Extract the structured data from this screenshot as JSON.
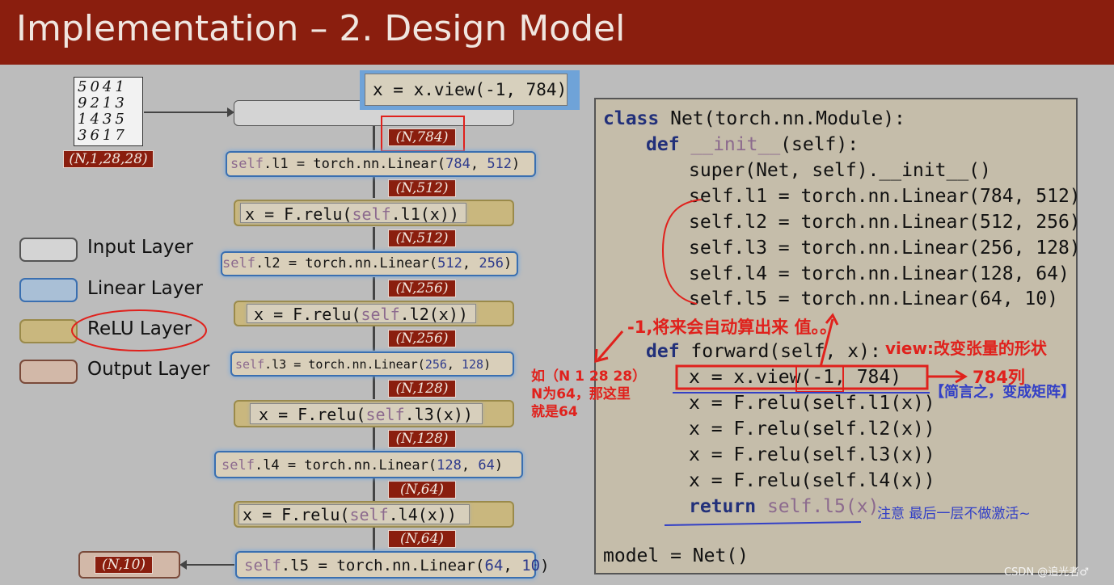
{
  "title": "Implementation – 2. Design Model",
  "input_shape": "(N,1,28,28)",
  "digits": [
    "5041",
    "9213",
    "1435",
    "3617"
  ],
  "flow": {
    "view": "x = x.view(-1, 784)",
    "shapes": [
      "(N,784)",
      "(N,512)",
      "(N,512)",
      "(N,256)",
      "(N,256)",
      "(N,128)",
      "(N,128)",
      "(N,64)",
      "(N,64)"
    ],
    "output_shape": "(N,10)",
    "linear": [
      {
        "pre": "self",
        "mid": ".l1 = torch.nn.Linear(",
        "a": "784",
        "sep": ", ",
        "b": "512",
        "post": ")"
      },
      {
        "pre": "self",
        "mid": ".l2 = torch.nn.Linear(",
        "a": "512",
        "sep": ", ",
        "b": "256",
        "post": ")"
      },
      {
        "pre": "self",
        "mid": ".l3 = torch.nn.Linear(",
        "a": "256",
        "sep": ", ",
        "b": "128",
        "post": ")"
      },
      {
        "pre": "self",
        "mid": ".l4 = torch.nn.Linear(",
        "a": "128",
        "sep": ", ",
        "b": "64",
        "post": ")"
      },
      {
        "pre": "self",
        "mid": ".l5 = torch.nn.Linear(",
        "a": "64",
        "sep": ", ",
        "b": "10",
        "post": ")"
      }
    ],
    "relu": [
      {
        "pre": "x = F.relu(",
        "self": "self",
        "post": ".l1(x))"
      },
      {
        "pre": "x = F.relu(",
        "self": "self",
        "post": ".l2(x))"
      },
      {
        "pre": "x = F.relu(",
        "self": "self",
        "post": ".l3(x))"
      },
      {
        "pre": "x = F.relu(",
        "self": "self",
        "post": ".l4(x))"
      }
    ]
  },
  "legend": [
    {
      "label": "Input Layer",
      "fill": "#d4d4d4",
      "border": "#555555"
    },
    {
      "label": "Linear Layer",
      "fill": "#a9bfd6",
      "border": "#3a6fb0"
    },
    {
      "label": "ReLU Layer",
      "fill": "#c9b77e",
      "border": "#9a8a4a"
    },
    {
      "label": "Output Layer",
      "fill": "#d2b8a8",
      "border": "#7a4a3a"
    }
  ],
  "code": {
    "class_kw": "class",
    "class_rest": " Net(torch.nn.Module):",
    "def_kw": "def",
    "init_name": " __init__",
    "init_args": "(self):",
    "super_line": "super(Net, self).__init__()",
    "l1": "self.l1 = torch.nn.Linear(784, 512)",
    "l2": "self.l2 = torch.nn.Linear(512, 256)",
    "l3": "self.l3 = torch.nn.Linear(256, 128)",
    "l4": "self.l4 = torch.nn.Linear(128, 64)",
    "l5": "self.l5 = torch.nn.Linear(64, 10)",
    "forward_kw": "def",
    "forward_rest": " forward(self, x):",
    "view_line": "x = x.view(-1, 784)",
    "r1": "x = F.relu(self.l1(x))",
    "r2": "x = F.relu(self.l2(x))",
    "r3": "x = F.relu(self.l3(x))",
    "r4": "x = F.relu(self.l4(x))",
    "return_kw": "return",
    "return_rest": " self.l5(x)",
    "model_line": "model = Net()"
  },
  "annotations": {
    "minus_one": "-1,将来会自动算出来 值。。",
    "view_note": "view:改变张量的形状",
    "cols": "784列",
    "matrix": "【简言之，变成矩阵】",
    "example1": "如（N 1 28 28）",
    "example2": "N为64，那这里",
    "example3": "就是64",
    "no_activation": "注意 最后一层不做激活~"
  },
  "watermark": "CSDN @追光者♂"
}
